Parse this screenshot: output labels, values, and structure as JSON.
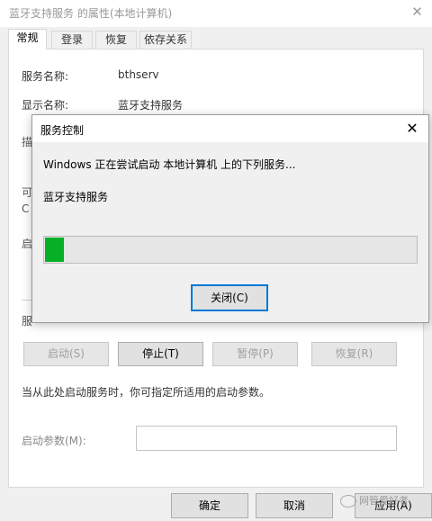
{
  "window": {
    "title": "蓝牙支持服务 的属性(本地计算机)",
    "close_glyph": "✕"
  },
  "tabs": [
    {
      "label": "常规",
      "active": true
    },
    {
      "label": "登录",
      "active": false
    },
    {
      "label": "恢复",
      "active": false
    },
    {
      "label": "依存关系",
      "active": false
    }
  ],
  "general": {
    "service_name_label": "服务名称:",
    "service_name_value": "bthserv",
    "display_name_label": "显示名称:",
    "display_name_value": "蓝牙支持服务",
    "partial_labels": [
      "描",
      "可",
      "C",
      "启",
      "服"
    ],
    "service_buttons": [
      {
        "label": "启动(S)",
        "enabled": false
      },
      {
        "label": "停止(T)",
        "enabled": true
      },
      {
        "label": "暂停(P)",
        "enabled": false
      },
      {
        "label": "恢复(R)",
        "enabled": false
      }
    ],
    "start_params_hint": "当从此处启动服务时，你可指定所适用的启动参数。",
    "start_params_label": "启动参数(M):",
    "start_params_value": ""
  },
  "footer": {
    "ok_label": "确定",
    "cancel_label": "取消",
    "apply_label": "应用(A)"
  },
  "watermark": "网管爱好者",
  "dialog": {
    "title": "服务控制",
    "close_glyph": "✕",
    "message": "Windows 正在尝试启动 本地计算机 上的下列服务...",
    "service": "蓝牙支持服务",
    "progress": 0.05,
    "progress_color": "#06b025",
    "close_button_label": "关闭(C)"
  }
}
